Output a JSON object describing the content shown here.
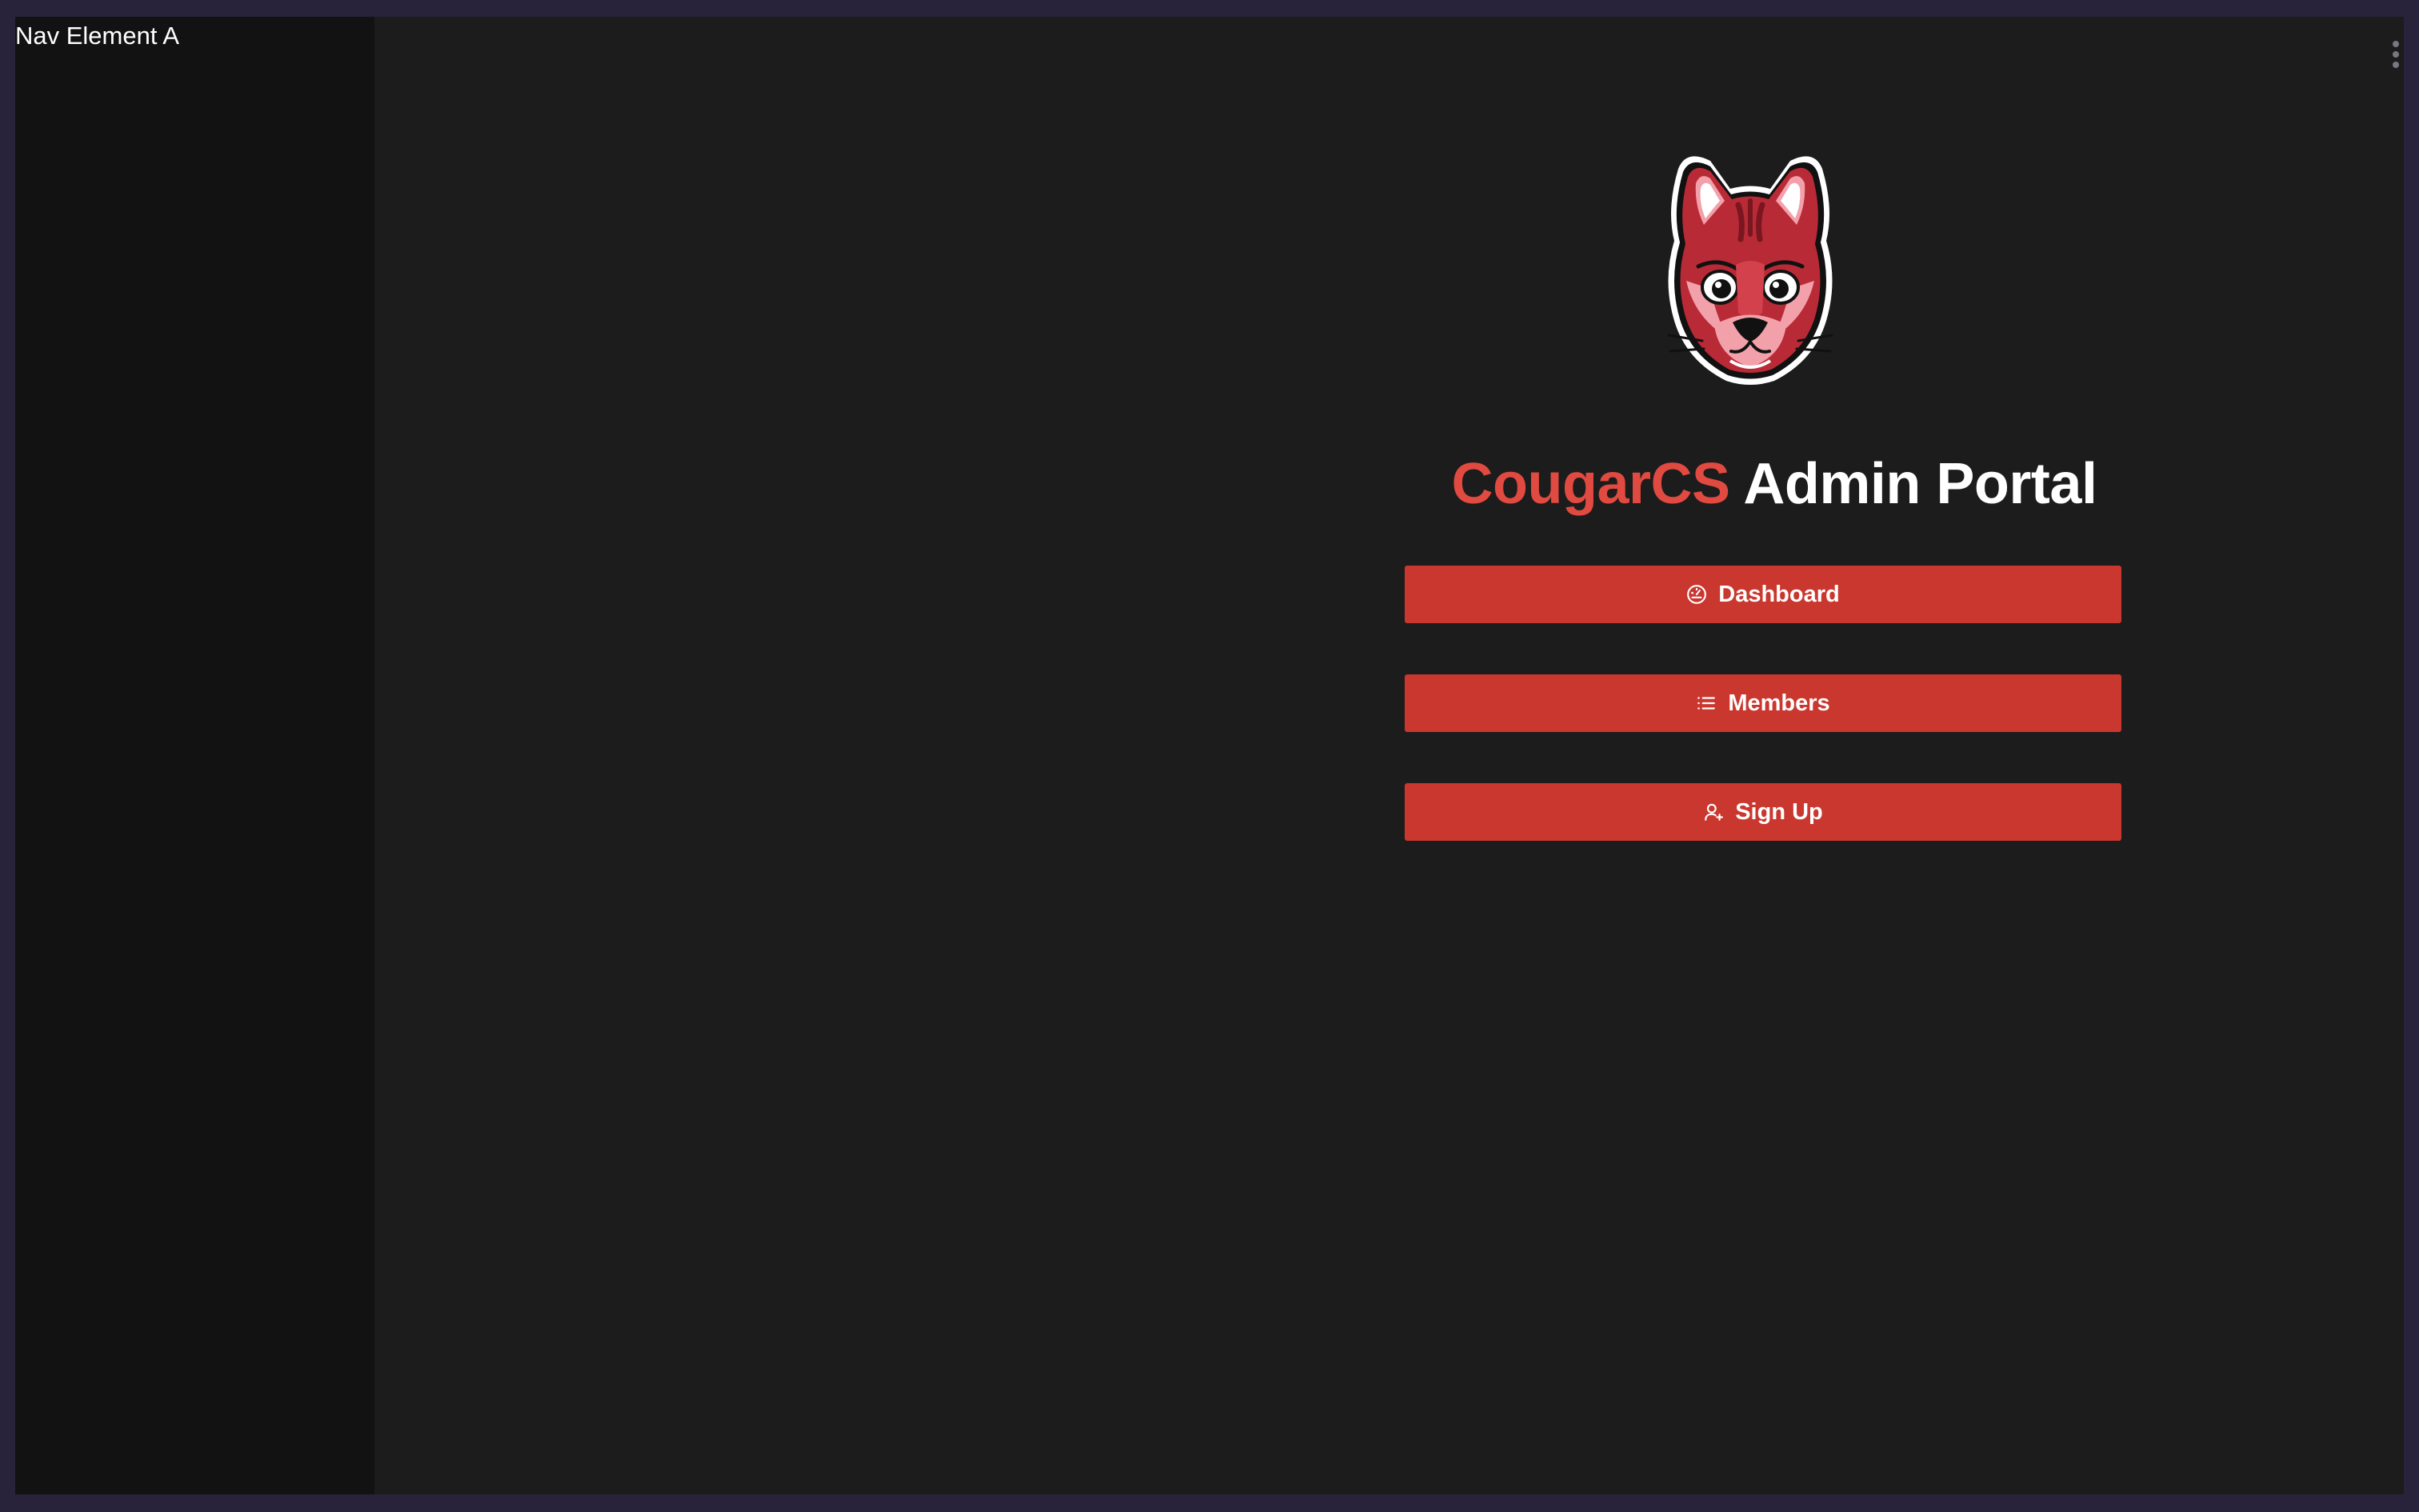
{
  "sidebar": {
    "nav_item": "Nav Element A"
  },
  "header": {
    "title_accent": "CougarCS",
    "title_rest": " Admin Portal"
  },
  "logo": {
    "icon": "cougar-mascot-icon"
  },
  "buttons": [
    {
      "label": "Dashboard",
      "icon": "gauge-icon"
    },
    {
      "label": "Members",
      "icon": "list-icon"
    },
    {
      "label": "Sign Up",
      "icon": "user-plus-icon"
    }
  ],
  "colors": {
    "accent": "#e04a40",
    "button": "#c9372f",
    "background": "#1c1c1c",
    "sidebar": "#121212",
    "frame": "#28223a"
  }
}
